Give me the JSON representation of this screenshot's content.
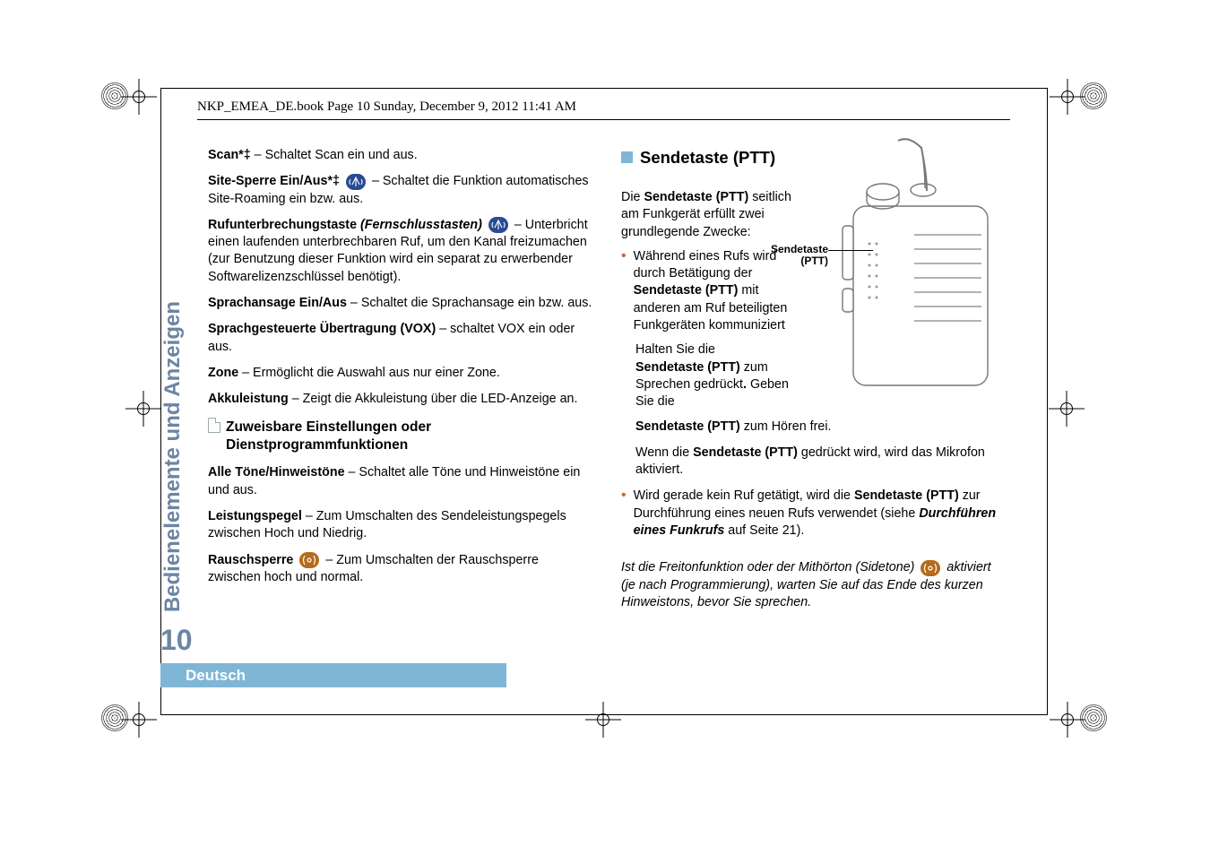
{
  "header": "NKP_EMEA_DE.book  Page 10  Sunday, December 9, 2012  11:41 AM",
  "sideTab": "Bedienelemente und Anzeigen",
  "pageNum": "10",
  "langBar": "Deutsch",
  "left": {
    "scan": {
      "term": "Scan*‡",
      "text": " – Schaltet Scan ein und aus."
    },
    "sitelock": {
      "term": "Site-Sperre Ein/Aus*‡",
      "text": " – Schaltet die Funktion automatisches Site-Roaming ein bzw. aus."
    },
    "callint": {
      "term": "Rufunterbrechungstaste",
      "term2": " (Fernschlusstasten)",
      "text": " – Unterbricht einen laufenden unterbrechbaren Ruf, um den Kanal freizumachen (zur Benutzung dieser Funktion wird ein separat zu erwerbender Softwarelizenzschlüssel benötigt)."
    },
    "voice": {
      "term": "Sprachansage Ein/Aus",
      "text": " – Schaltet die Sprachansage ein bzw. aus."
    },
    "vox": {
      "term": "Sprachgesteuerte Übertragung (VOX)",
      "text": " – schaltet VOX ein oder aus."
    },
    "zone": {
      "term": "Zone",
      "text": " – Ermöglicht die Auswahl aus nur einer Zone."
    },
    "akku": {
      "term": "Akkuleistung",
      "text": " – Zeigt die Akkuleistung über die LED-Anzeige an."
    },
    "secHead1": "Zuweisbare Einstellungen oder",
    "secHead2": "Dienstprogrammfunktionen",
    "tones": {
      "term": "Alle Töne/Hinweistöne",
      "text": " – Schaltet alle Töne und Hinweistöne ein und aus."
    },
    "power": {
      "term": "Leistungspegel",
      "text": " – Zum Umschalten des Sendeleistungspegels zwischen Hoch und Niedrig."
    },
    "squelch": {
      "term": "Rauschsperre",
      "text": " – Zum Umschalten der Rauschsperre zwischen hoch und normal."
    }
  },
  "right": {
    "heading": "Sendetaste (PTT)",
    "intro1a": "Die ",
    "intro1b": "Sendetaste (PTT)",
    "intro1c": " seitlich am Funkgerät erfüllt zwei grundlegende Zwecke:",
    "b1a": "Während eines Rufs wird durch Betätigung der ",
    "b1b": "Sendetaste (PTT)",
    "b1c": " mit anderen am Ruf beteiligten Funkgeräten kommuniziert",
    "hold1a": "Halten Sie die",
    "hold1b": "Sendetaste (PTT)",
    "hold1c": " zum Sprechen gedrückt",
    "hold1d": ".",
    "hold2a": " Geben Sie die",
    "hold2b": "Sendetaste (PTT)",
    "hold2c": " zum Hören frei.",
    "mic1": "Wenn die ",
    "mic2": "Sendetaste (PTT)",
    "mic3": " gedrückt wird, wird das Mikrofon aktiviert.",
    "b2a": "Wird gerade kein Ruf getätigt, wird die ",
    "b2b": "Sendetaste (PTT)",
    "b2c": " zur Durchführung eines neuen Rufs verwendet (siehe ",
    "b2d": "Durchführen eines Funkrufs",
    "b2e": " auf Seite 21).",
    "note1": "Ist die Freitonfunktion oder der Mithörton (Sidetone) ",
    "note2": "  aktiviert (je nach Programmierung), warten Sie auf das Ende des kurzen Hinweistons, bevor Sie sprechen.",
    "pttLabel1": "Sendetaste",
    "pttLabel2": "(PTT)"
  }
}
